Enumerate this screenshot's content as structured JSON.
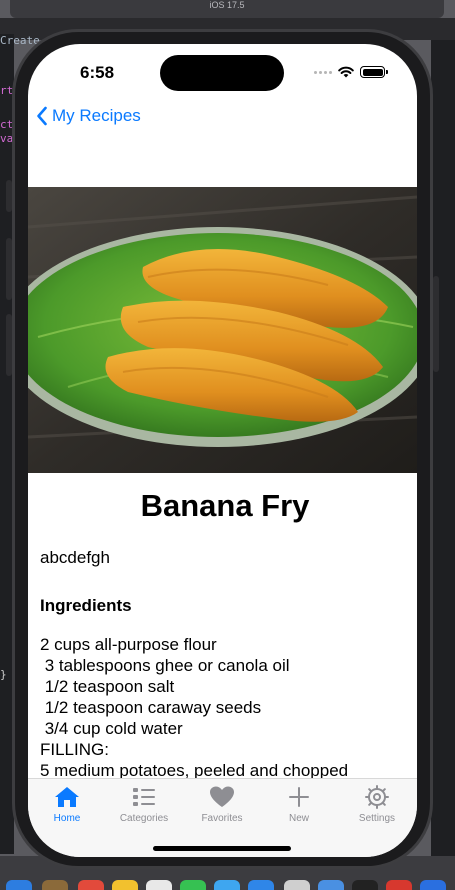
{
  "simulator": {
    "title": "iOS 17.5"
  },
  "ide": {
    "create_text": "Create",
    "margin_snippets": [
      "rt",
      "ct",
      "va",
      "}"
    ]
  },
  "status_bar": {
    "time": "6:58"
  },
  "nav": {
    "back_label": "My Recipes"
  },
  "recipe": {
    "title": "Banana Fry",
    "description": "abcdefgh",
    "ingredients_heading": "Ingredients",
    "ingredients": [
      "2 cups all-purpose flour",
      " 3 tablespoons ghee or canola oil",
      " 1/2 teaspoon salt",
      " 1/2 teaspoon caraway seeds",
      " 3/4 cup cold water",
      "FILLING:",
      "5 medium potatoes, peeled and chopped"
    ]
  },
  "tab_bar": {
    "tabs": [
      {
        "label": "Home",
        "icon": "house-icon",
        "active": true
      },
      {
        "label": "Categories",
        "icon": "list-icon",
        "active": false
      },
      {
        "label": "Favorites",
        "icon": "heart-icon",
        "active": false
      },
      {
        "label": "New",
        "icon": "plus-icon",
        "active": false
      },
      {
        "label": "Settings",
        "icon": "gear-icon",
        "active": false
      }
    ]
  },
  "colors": {
    "accent": "#0a7aff",
    "inactive": "#8e8e93"
  }
}
